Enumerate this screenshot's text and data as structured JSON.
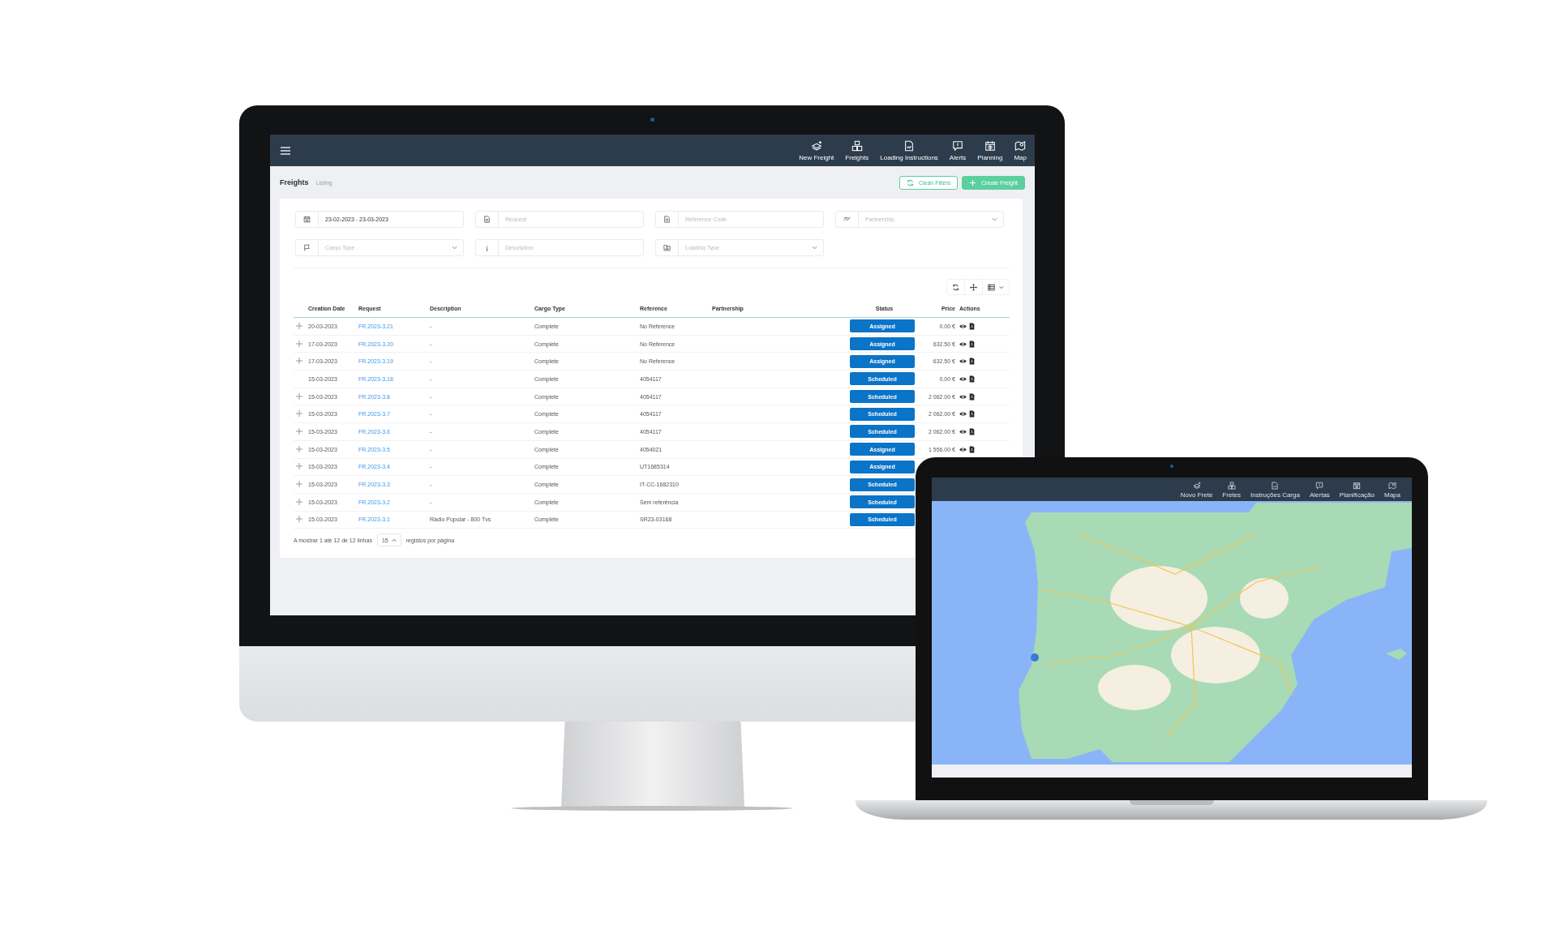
{
  "monitor": {
    "nav": [
      {
        "label": "New Freight"
      },
      {
        "label": "Freights"
      },
      {
        "label": "Loading Instructions"
      },
      {
        "label": "Alerts"
      },
      {
        "label": "Planning"
      },
      {
        "label": "Map"
      }
    ],
    "breadcrumb": {
      "title": "Freights",
      "subtitle": "Listing"
    },
    "buttons": [
      {
        "label": "Clean Filters",
        "kind": "outline"
      },
      {
        "label": "Create Freight",
        "kind": "primary"
      }
    ],
    "filters": [
      {
        "kind": "text",
        "value": "23-02-2023 - 23-03-2023"
      },
      {
        "kind": "text",
        "placeholder": "Request"
      },
      {
        "kind": "text",
        "placeholder": "Reference Code"
      },
      {
        "kind": "select",
        "placeholder": "Partnership"
      },
      {
        "kind": "select",
        "placeholder": "Cargo Type"
      },
      {
        "kind": "text",
        "placeholder": "Description"
      },
      {
        "kind": "select",
        "placeholder": "Loading Type"
      }
    ],
    "table": {
      "columns": [
        "Creation Date",
        "Request",
        "Description",
        "Cargo Type",
        "Reference",
        "Partnership",
        "Status",
        "Price",
        "Actions"
      ],
      "rows": [
        {
          "expandable": true,
          "creation_date": "20-03-2023",
          "request": "FR.2023-3.21",
          "description": "-",
          "cargo_type": "Complete",
          "reference": "No Reference",
          "status": "Assigned",
          "price": "0.00 €"
        },
        {
          "expandable": true,
          "creation_date": "17-03-2023",
          "request": "FR.2023-3.20",
          "description": "-",
          "cargo_type": "Complete",
          "reference": "No Reference",
          "status": "Assigned",
          "price": "632.50 €"
        },
        {
          "expandable": true,
          "creation_date": "17-03-2023",
          "request": "FR.2023-3.19",
          "description": "-",
          "cargo_type": "Complete",
          "reference": "No Reference",
          "status": "Assigned",
          "price": "632.50 €"
        },
        {
          "expandable": false,
          "creation_date": "15-03-2023",
          "request": "FR.2023-3.18",
          "description": "-",
          "cargo_type": "Complete",
          "reference": "4054117",
          "status": "Scheduled",
          "price": "0.00 €"
        },
        {
          "expandable": true,
          "creation_date": "15-03-2023",
          "request": "FR.2023-3.8",
          "description": "-",
          "cargo_type": "Complete",
          "reference": "4054117",
          "status": "Scheduled",
          "price": "2 062.00 €"
        },
        {
          "expandable": true,
          "creation_date": "15-03-2023",
          "request": "FR.2023-3.7",
          "description": "-",
          "cargo_type": "Complete",
          "reference": "4054117",
          "status": "Scheduled",
          "price": "2 062.00 €"
        },
        {
          "expandable": true,
          "creation_date": "15-03-2023",
          "request": "FR.2023-3.6",
          "description": "-",
          "cargo_type": "Complete",
          "reference": "4054117",
          "status": "Scheduled",
          "price": "2 062.00 €"
        },
        {
          "expandable": true,
          "creation_date": "15-03-2023",
          "request": "FR.2023-3.5",
          "description": "-",
          "cargo_type": "Complete",
          "reference": "4054021",
          "status": "Assigned",
          "price": "1 556.00 €"
        },
        {
          "expandable": true,
          "creation_date": "15-03-2023",
          "request": "FR.2023-3.4",
          "description": "-",
          "cargo_type": "Complete",
          "reference": "UT1685314",
          "status": "Assigned"
        },
        {
          "expandable": true,
          "creation_date": "15-03-2023",
          "request": "FR.2023-3.3",
          "description": "-",
          "cargo_type": "Complete",
          "reference": "IT-CC-1682310",
          "status": "Scheduled"
        },
        {
          "expandable": true,
          "creation_date": "15-03-2023",
          "request": "FR.2023-3.2",
          "description": "-",
          "cargo_type": "Complete",
          "reference": "Sem referência",
          "status": "Scheduled"
        },
        {
          "expandable": true,
          "creation_date": "15-03-2023",
          "request": "FR.2023-3.1",
          "description": "Rádio Popular - 800 Tvs",
          "cargo_type": "Complete",
          "reference": "SR23-03168",
          "status": "Scheduled"
        }
      ]
    },
    "footer": {
      "summary": "A mostrar 1 até 12 de 12 linhas",
      "page_size": "15",
      "suffix": "registos por página"
    }
  },
  "laptop": {
    "nav": [
      {
        "label": "Novo Frete"
      },
      {
        "label": "Fretes"
      },
      {
        "label": "Instruções Carga"
      },
      {
        "label": "Alertas"
      },
      {
        "label": "Planificação"
      },
      {
        "label": "Mapa"
      }
    ]
  }
}
